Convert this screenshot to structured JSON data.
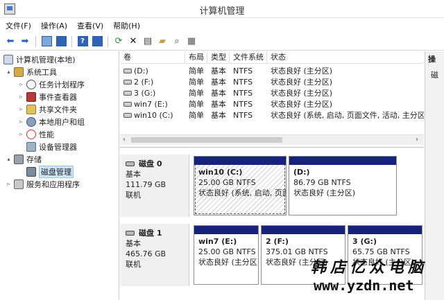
{
  "window": {
    "title": "计算机管理"
  },
  "menu": [
    "文件(F)",
    "操作(A)",
    "查看(V)",
    "帮助(H)"
  ],
  "toolbar": {
    "icons": [
      "back-arrow-icon",
      "forward-arrow-icon",
      "up-folder-icon",
      "show-tree-icon",
      "help-icon",
      "properties-icon",
      "refresh-icon",
      "delete-icon",
      "open-icon",
      "folder-open-icon",
      "search-icon",
      "settings-icon"
    ]
  },
  "tree": [
    {
      "label": "计算机管理(本地)",
      "level": 0,
      "expander": "",
      "icon": "computer"
    },
    {
      "label": "系统工具",
      "level": 1,
      "expander": "▴",
      "icon": "tools"
    },
    {
      "label": "任务计划程序",
      "level": 2,
      "expander": "▹",
      "icon": "clock"
    },
    {
      "label": "事件查看器",
      "level": 2,
      "expander": "▹",
      "icon": "event"
    },
    {
      "label": "共享文件夹",
      "level": 2,
      "expander": "▹",
      "icon": "share"
    },
    {
      "label": "本地用户和组",
      "level": 2,
      "expander": "▹",
      "icon": "users"
    },
    {
      "label": "性能",
      "level": 2,
      "expander": "▹",
      "icon": "perf"
    },
    {
      "label": "设备管理器",
      "level": 2,
      "expander": "",
      "icon": "device"
    },
    {
      "label": "存储",
      "level": 1,
      "expander": "▴",
      "icon": "storage"
    },
    {
      "label": "磁盘管理",
      "level": 2,
      "expander": "",
      "icon": "disk",
      "selected": true
    },
    {
      "label": "服务和应用程序",
      "level": 1,
      "expander": "▹",
      "icon": "services"
    }
  ],
  "volumes": {
    "columns": [
      "卷",
      "布局",
      "类型",
      "文件系统",
      "状态"
    ],
    "rows": [
      {
        "name": "(D:)",
        "layout": "简单",
        "type": "基本",
        "fs": "NTFS",
        "status": "状态良好 (主分区)"
      },
      {
        "name": "2 (F:)",
        "layout": "简单",
        "type": "基本",
        "fs": "NTFS",
        "status": "状态良好 (主分区)"
      },
      {
        "name": "3 (G:)",
        "layout": "简单",
        "type": "基本",
        "fs": "NTFS",
        "status": "状态良好 (主分区)"
      },
      {
        "name": "win7 (E:)",
        "layout": "简单",
        "type": "基本",
        "fs": "NTFS",
        "status": "状态良好 (主分区)"
      },
      {
        "name": "win10 (C:)",
        "layout": "简单",
        "type": "基本",
        "fs": "NTFS",
        "status": "状态良好 (系统, 启动, 页面文件, 活动, 主分区)"
      }
    ]
  },
  "disks": [
    {
      "name": "磁盘 0",
      "kind": "基本",
      "size": "111.79 GB",
      "state": "联机",
      "partitions": [
        {
          "title": "win10  (C:)",
          "size": "25.00 GB NTFS",
          "status": "状态良好 (系统, 启动, 页面",
          "hatched": true
        },
        {
          "title": "(D:)",
          "size": "86.79 GB NTFS",
          "status": "状态良好 (主分区)",
          "hatched": false
        }
      ]
    },
    {
      "name": "磁盘 1",
      "kind": "基本",
      "size": "465.76 GB",
      "state": "联机",
      "partitions": [
        {
          "title": "win7  (E:)",
          "size": "25.00 GB NTFS",
          "status": "状态良好 (主分区)",
          "hatched": false
        },
        {
          "title": "2  (F:)",
          "size": "375.01 GB NTFS",
          "status": "状态良好 (主分区)",
          "hatched": false
        },
        {
          "title": "3  (G:)",
          "size": "65.75 GB NTFS",
          "status": "状态良好 (主分区)",
          "hatched": false
        }
      ]
    }
  ],
  "actions": {
    "header": "操",
    "item": "磁"
  },
  "watermark": {
    "brand": "韩店亿众电脑",
    "url": "www.yzdn.net"
  },
  "colors": {
    "partition_bar": "#17237a",
    "selected_bg": "#cce4f7"
  }
}
